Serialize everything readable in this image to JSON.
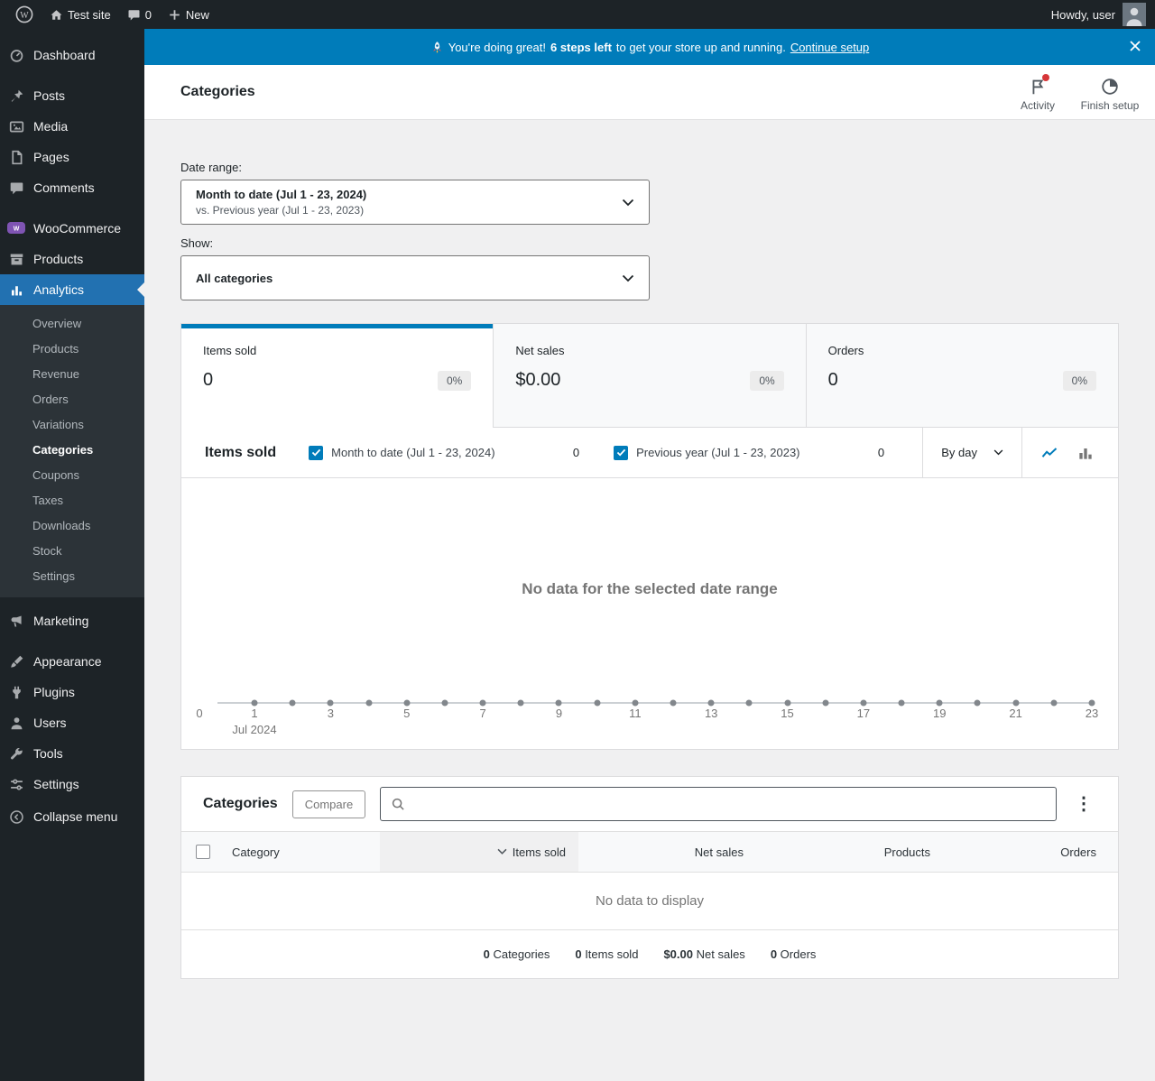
{
  "colors": {
    "accent": "#007cba",
    "sidebar_active": "#2271b1",
    "woocommerce_purple": "#7f54b3",
    "alert_red": "#d63638",
    "sidebar_bg": "#1d2327",
    "page_bg": "#f0f0f1"
  },
  "adminbar": {
    "site_name": "Test site",
    "comment_count": "0",
    "new_label": "New",
    "howdy": "Howdy, user"
  },
  "sidebar": {
    "items": {
      "dashboard": "Dashboard",
      "posts": "Posts",
      "media": "Media",
      "pages": "Pages",
      "comments": "Comments",
      "woocommerce": "WooCommerce",
      "products": "Products",
      "analytics": "Analytics",
      "marketing": "Marketing",
      "appearance": "Appearance",
      "plugins": "Plugins",
      "users": "Users",
      "tools": "Tools",
      "settings": "Settings",
      "collapse": "Collapse menu"
    },
    "analytics_submenu": [
      "Overview",
      "Products",
      "Revenue",
      "Orders",
      "Variations",
      "Categories",
      "Coupons",
      "Taxes",
      "Downloads",
      "Stock",
      "Settings"
    ],
    "active_item": "Analytics",
    "active_submenu_item": "Categories"
  },
  "banner": {
    "message_prefix": "You're doing great!",
    "steps_highlight": "6 steps left",
    "message_suffix": "to get your store up and running.",
    "link_label": "Continue setup"
  },
  "header": {
    "page_title": "Categories",
    "activity_label": "Activity",
    "finish_setup_label": "Finish setup"
  },
  "filters": {
    "date_range_label": "Date range:",
    "date_range_value": "Month to date (Jul 1 - 23, 2024)",
    "date_range_comparison": "vs. Previous year (Jul 1 - 23, 2023)",
    "show_label": "Show:",
    "show_value": "All categories"
  },
  "stats": {
    "tabs": [
      {
        "label": "Items sold",
        "value": "0",
        "delta": "0%",
        "active": true
      },
      {
        "label": "Net sales",
        "value": "$0.00",
        "delta": "0%",
        "active": false
      },
      {
        "label": "Orders",
        "value": "0",
        "delta": "0%",
        "active": false
      }
    ]
  },
  "chart": {
    "title": "Items sold",
    "legend": [
      {
        "label": "Month to date (Jul 1 - 23, 2024)",
        "value": "0",
        "checked": true
      },
      {
        "label": "Previous year (Jul 1 - 23, 2023)",
        "value": "0",
        "checked": true
      }
    ],
    "interval": "By day",
    "empty_message": "No data for the selected date range",
    "y_zero_label": "0",
    "days": 23,
    "x_ticks": [
      1,
      3,
      5,
      7,
      9,
      11,
      13,
      15,
      17,
      19,
      21,
      23
    ],
    "x_sublabel": "Jul 2024"
  },
  "table": {
    "title": "Categories",
    "compare_label": "Compare",
    "search_placeholder": "",
    "columns": [
      "Category",
      "Items sold",
      "Net sales",
      "Products",
      "Orders"
    ],
    "sorted_column": "Items sold",
    "sort_direction": "desc",
    "empty_message": "No data to display",
    "summary": [
      {
        "value": "0",
        "label": "Categories"
      },
      {
        "value": "0",
        "label": "Items sold"
      },
      {
        "value": "$0.00",
        "label": "Net sales"
      },
      {
        "value": "0",
        "label": "Orders"
      }
    ]
  }
}
